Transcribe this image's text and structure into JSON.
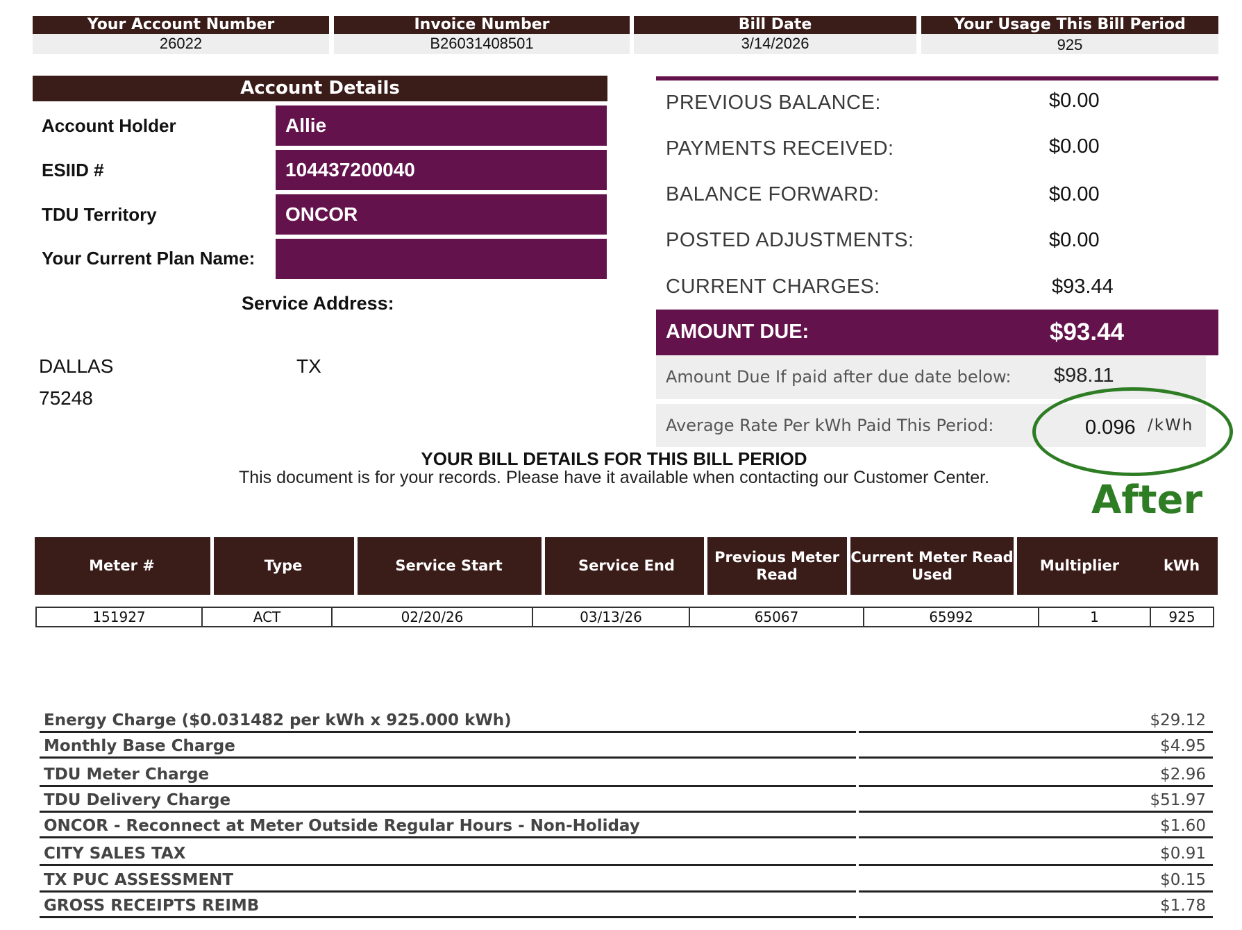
{
  "header": [
    {
      "title": "Your Account Number",
      "value": "26022"
    },
    {
      "title": "Invoice Number",
      "value": "B26031408501"
    },
    {
      "title": "Bill Date",
      "value": "3/14/2026"
    },
    {
      "title": "Your Usage This Bill Period",
      "value": "925"
    }
  ],
  "account_details": {
    "title": "Account Details",
    "rows": [
      {
        "label": "Account Holder",
        "value": "Allie"
      },
      {
        "label": "ESIID #",
        "value": "104437200040"
      },
      {
        "label": "TDU Territory",
        "value": "ONCOR"
      },
      {
        "label": "Your Current Plan Name:",
        "value": ""
      }
    ],
    "service_address_label": "Service Address:",
    "city": "DALLAS",
    "state": "TX",
    "zip": "75248"
  },
  "balance": {
    "rows": [
      {
        "label": "PREVIOUS BALANCE:",
        "value": "$0.00"
      },
      {
        "label": "PAYMENTS RECEIVED:",
        "value": "$0.00"
      },
      {
        "label": "BALANCE FORWARD:",
        "value": "$0.00"
      },
      {
        "label": "POSTED ADJUSTMENTS:",
        "value": "$0.00"
      },
      {
        "label": "CURRENT CHARGES:",
        "value": "$93.44"
      }
    ],
    "amount_due_label": "AMOUNT DUE:",
    "amount_due_value": "$93.44",
    "late_label": "Amount Due If paid after due date below:",
    "late_value": "$98.11",
    "avg_rate_label": "Average Rate Per kWh Paid This Period:",
    "avg_rate_value": "0.096",
    "avg_rate_unit": "/kWh"
  },
  "annotation": {
    "text": "After",
    "color": "#2e7d24"
  },
  "bill_details": {
    "title": "YOUR BILL DETAILS FOR THIS BILL PERIOD",
    "note": "This document is for your records. Please have it available when contacting our Customer Center."
  },
  "meter_table": {
    "headers": [
      "Meter #",
      "Type",
      "Service Start",
      "Service End",
      "Previous Meter Read",
      "Current Meter Read Used",
      "Multiplier",
      "kWh"
    ],
    "rows": [
      [
        "151927",
        "ACT",
        "02/20/26",
        "03/13/26",
        "65067",
        "65992",
        "1",
        "925"
      ]
    ]
  },
  "charges": [
    {
      "description": "Energy Charge ($0.031482 per kWh x 925.000 kWh)",
      "amount": "$29.12"
    },
    {
      "description": "Monthly Base Charge",
      "amount": "$4.95"
    },
    {
      "description": "TDU Meter Charge",
      "amount": "$2.96"
    },
    {
      "description": "TDU Delivery Charge",
      "amount": "$51.97"
    },
    {
      "description": "ONCOR - Reconnect at Meter Outside Regular Hours - Non-Holiday",
      "amount": "$1.60"
    },
    {
      "description": "CITY SALES TAX",
      "amount": "$0.91"
    },
    {
      "description": "TX PUC ASSESSMENT",
      "amount": "$0.15"
    },
    {
      "description": "GROSS RECEIPTS REIMB",
      "amount": "$1.78"
    }
  ],
  "colors": {
    "header_brown": "#3a1c19",
    "plum": "#64124c",
    "light_grey": "#eeeeee"
  }
}
